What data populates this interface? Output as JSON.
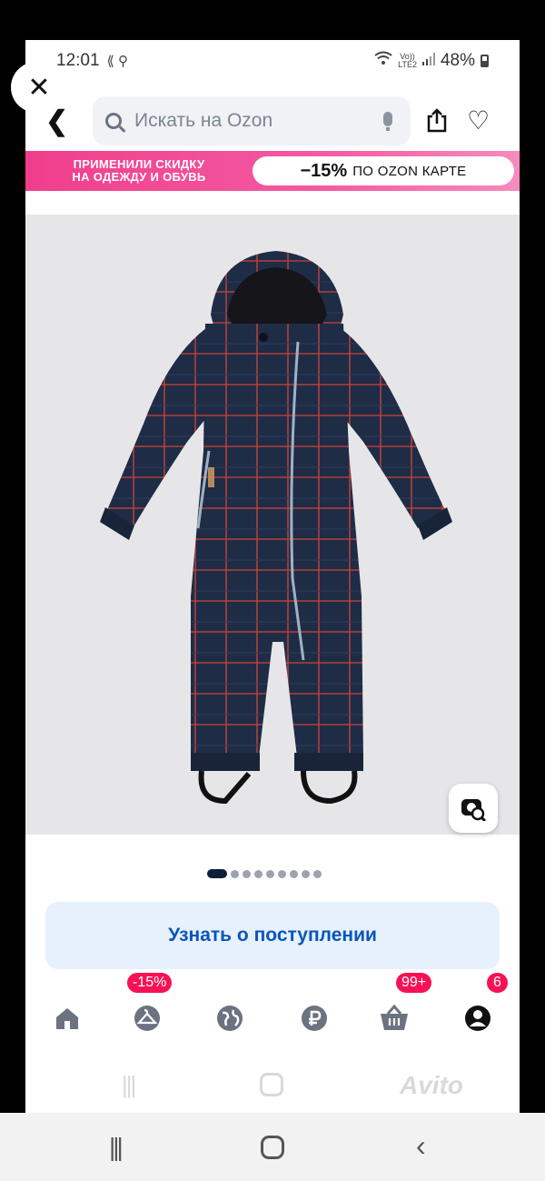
{
  "status_bar": {
    "time": "12:01",
    "net_top": "Vo))",
    "net_bottom": "LTE2",
    "battery": "48%"
  },
  "search": {
    "placeholder": "Искать на Ozon"
  },
  "promo": {
    "line1": "ПРИМЕНИЛИ СКИДКУ",
    "line2": "НА ОДЕЖДУ И ОБУВЬ",
    "discount": "−15%",
    "card_text": "ПО OZON КАРТЕ"
  },
  "gallery": {
    "total": 9,
    "active": 1
  },
  "notify_label": "Узнать о поступлении",
  "nav": {
    "items": [
      {
        "icon": "home-icon"
      },
      {
        "icon": "hanger-icon",
        "badge": "-15%"
      },
      {
        "icon": "globe-icon"
      },
      {
        "icon": "ruble-icon"
      },
      {
        "icon": "cart-icon",
        "badge": "99+"
      },
      {
        "icon": "profile-icon",
        "badge": "6"
      }
    ]
  },
  "watermark": "Avito",
  "colors": {
    "brand_blue": "#005bff",
    "promo_pink": "#f03e8c",
    "badge": "#f91155",
    "product_navy": "#1f2c46",
    "plaid_red": "#c8423a"
  }
}
